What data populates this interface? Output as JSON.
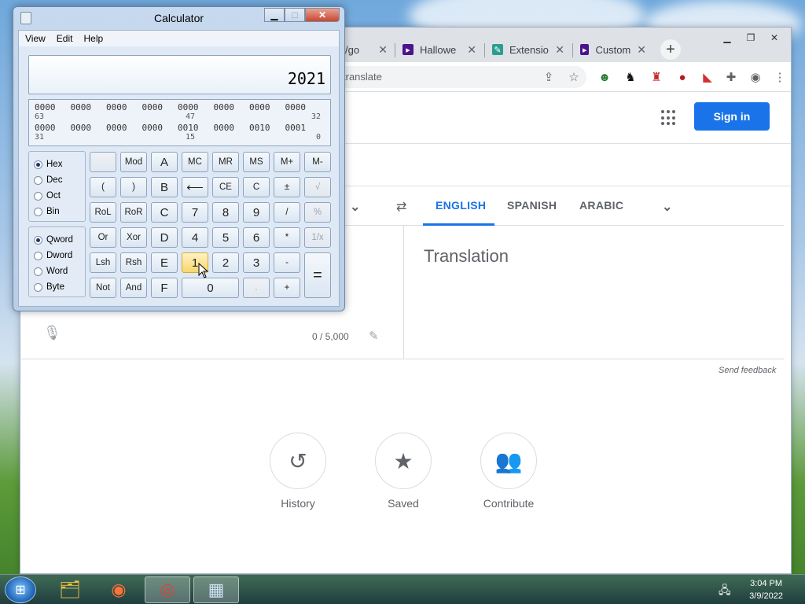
{
  "calculator": {
    "title": "Calculator",
    "menu": [
      "View",
      "Edit",
      "Help"
    ],
    "display": "2021",
    "bits": {
      "row1": [
        "0000",
        "0000",
        "0000",
        "0000",
        "0000",
        "0000",
        "0000",
        "0000"
      ],
      "row1_idx": [
        "63",
        "47",
        "32"
      ],
      "row2": [
        "0000",
        "0000",
        "0000",
        "0000",
        "0010",
        "0000",
        "0010",
        "0001"
      ],
      "row2_idx": [
        "31",
        "15",
        "0"
      ]
    },
    "base_options": [
      "Hex",
      "Dec",
      "Oct",
      "Bin"
    ],
    "base_selected": "Hex",
    "word_options": [
      "Qword",
      "Dword",
      "Word",
      "Byte"
    ],
    "word_selected": "Qword",
    "keys": {
      "mod": "Mod",
      "a": "A",
      "mc": "MC",
      "mr": "MR",
      "ms": "MS",
      "mplus": "M+",
      "mminus": "M-",
      "lparen": "(",
      "rparen": ")",
      "b": "B",
      "back": "⟵",
      "ce": "CE",
      "c": "C",
      "pm": "±",
      "sqrt": "√",
      "rol": "RoL",
      "ror": "RoR",
      "c_hex": "C",
      "k7": "7",
      "k8": "8",
      "k9": "9",
      "div": "/",
      "pct": "%",
      "or": "Or",
      "xor": "Xor",
      "d": "D",
      "k4": "4",
      "k5": "5",
      "k6": "6",
      "mul": "*",
      "recip": "1/x",
      "lsh": "Lsh",
      "rsh": "Rsh",
      "e": "E",
      "k1": "1",
      "k2": "2",
      "k3": "3",
      "sub": "-",
      "eq": "=",
      "not": "Not",
      "and": "And",
      "f": "F",
      "k0": "0",
      "dot": ".",
      "add": "+"
    }
  },
  "browser": {
    "tabs": [
      {
        "label": "/go",
        "icon": "google-icon"
      },
      {
        "label": "Hallowe",
        "icon": "cursor-icon"
      },
      {
        "label": "Extensio",
        "icon": "extensions-icon"
      },
      {
        "label": "Custom",
        "icon": "cursor-icon"
      }
    ],
    "url": "translate",
    "sign_in": "Sign in",
    "languages": [
      "ENGLISH",
      "SPANISH",
      "ARABIC"
    ],
    "active_language": "ENGLISH",
    "translation_placeholder": "Translation",
    "char_count": "0 / 5,000",
    "send_feedback": "Send feedback",
    "quick_actions": [
      {
        "label": "History",
        "icon": "history-icon"
      },
      {
        "label": "Saved",
        "icon": "star-icon"
      },
      {
        "label": "Contribute",
        "icon": "people-icon"
      }
    ]
  },
  "taskbar": {
    "time": "3:04 PM",
    "date": "3/9/2022",
    "apps": [
      "explorer-icon",
      "firefox-icon",
      "chrome-icon",
      "calculator-icon"
    ]
  }
}
